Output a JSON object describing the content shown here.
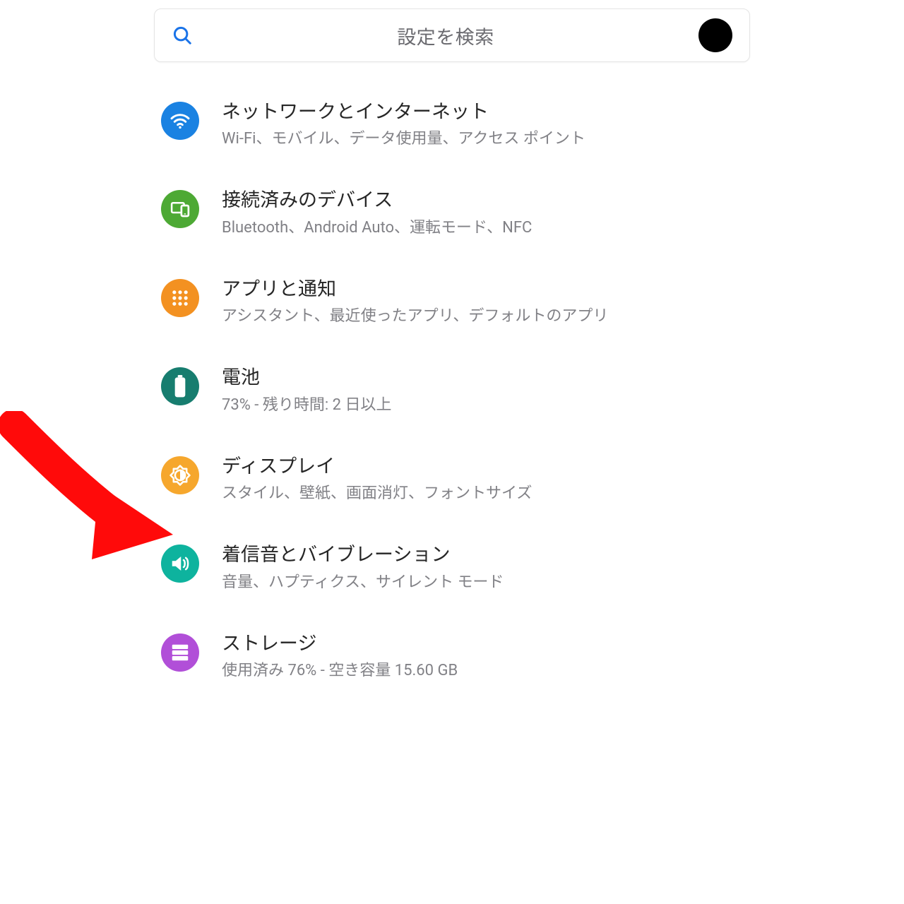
{
  "search": {
    "placeholder": "設定を検索"
  },
  "items": [
    {
      "icon": "wifi-icon",
      "color": "c-blue",
      "title": "ネットワークとインターネット",
      "subtitle": "Wi-Fi、モバイル、データ使用量、アクセス ポイント"
    },
    {
      "icon": "devices-icon",
      "color": "c-green",
      "title": "接続済みのデバイス",
      "subtitle": "Bluetooth、Android Auto、運転モード、NFC"
    },
    {
      "icon": "apps-icon",
      "color": "c-orange",
      "title": "アプリと通知",
      "subtitle": "アシスタント、最近使ったアプリ、デフォルトのアプリ"
    },
    {
      "icon": "battery-icon",
      "color": "c-teal",
      "title": "電池",
      "subtitle": "73% - 残り時間: 2 日以上"
    },
    {
      "icon": "brightness-icon",
      "color": "c-amber",
      "title": "ディスプレイ",
      "subtitle": "スタイル、壁紙、画面消灯、フォントサイズ"
    },
    {
      "icon": "volume-icon",
      "color": "c-cyan",
      "title": "着信音とバイブレーション",
      "subtitle": "音量、ハプティクス、サイレント モード"
    },
    {
      "icon": "storage-icon",
      "color": "c-purple",
      "title": "ストレージ",
      "subtitle": "使用済み 76% - 空き容量 15.60 GB"
    }
  ],
  "annotation": {
    "highlighted_item_index": 4
  }
}
